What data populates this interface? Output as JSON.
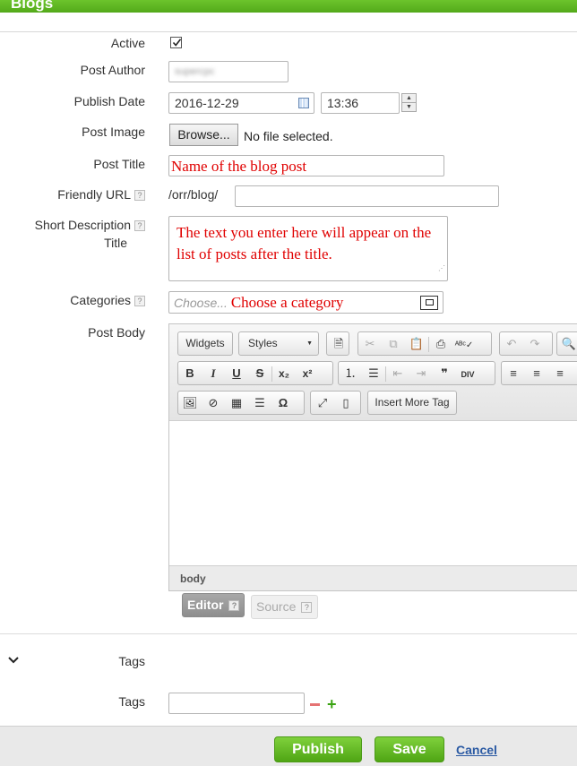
{
  "header": {
    "title": "Blogs"
  },
  "form": {
    "active": {
      "label": "Active",
      "checked": true
    },
    "post_author": {
      "label": "Post Author",
      "value": "supercpc"
    },
    "publish_date": {
      "label": "Publish Date",
      "date": "2016-12-29",
      "time": "13:36"
    },
    "post_image": {
      "label": "Post Image",
      "browse_label": "Browse...",
      "file_status": "No file selected."
    },
    "post_title": {
      "label": "Post Title",
      "value": "Name of the blog post"
    },
    "friendly_url": {
      "label": "Friendly URL",
      "prefix": "/orr/blog/",
      "value": ""
    },
    "short_description": {
      "label_line1": "Short Description",
      "label_line2": "Title",
      "value": "The text you enter here will appear on the list of posts after the title."
    },
    "categories": {
      "label": "Categories",
      "placeholder": "Choose...",
      "annotation": "Choose a category"
    },
    "post_body": {
      "label": "Post Body"
    }
  },
  "editor": {
    "widgets_label": "Widgets",
    "styles_label": "Styles",
    "insert_more_tag_label": "Insert More Tag",
    "status_path": "body",
    "tabs": [
      {
        "label": "Editor"
      },
      {
        "label": "Source"
      }
    ],
    "help_mark": "?"
  },
  "tags_section": {
    "toggle_label": "Tags",
    "field_label": "Tags",
    "value": ""
  },
  "footer": {
    "publish_label": "Publish",
    "save_label": "Save",
    "cancel_label": "Cancel"
  },
  "colors": {
    "brand_green": "#5cb520",
    "annotation_red": "#e00000",
    "link_blue": "#2b5aa3"
  }
}
